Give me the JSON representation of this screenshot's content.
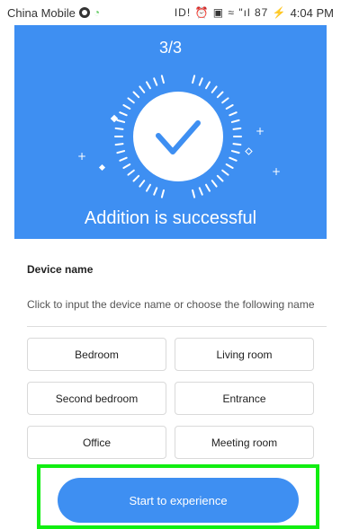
{
  "status_bar": {
    "carrier": "China Mobile",
    "icons_text": "ID! ⏰ ▣ ≈ \"ıl 87 ⚡",
    "time": "4:04 PM"
  },
  "hero": {
    "step": "3/3",
    "message": "Addition is successful",
    "background_color": "#3e8ff2",
    "icon": "check-circle-icon"
  },
  "device": {
    "label": "Device name",
    "hint": "Click to input the device name or choose the following name",
    "options": [
      "Bedroom",
      "Living room",
      "Second bedroom",
      "Entrance",
      "Office",
      "Meeting room"
    ]
  },
  "cta": {
    "label": "Start to experience"
  },
  "colors": {
    "accent": "#3e8ff2",
    "highlight": "#11ee11"
  }
}
